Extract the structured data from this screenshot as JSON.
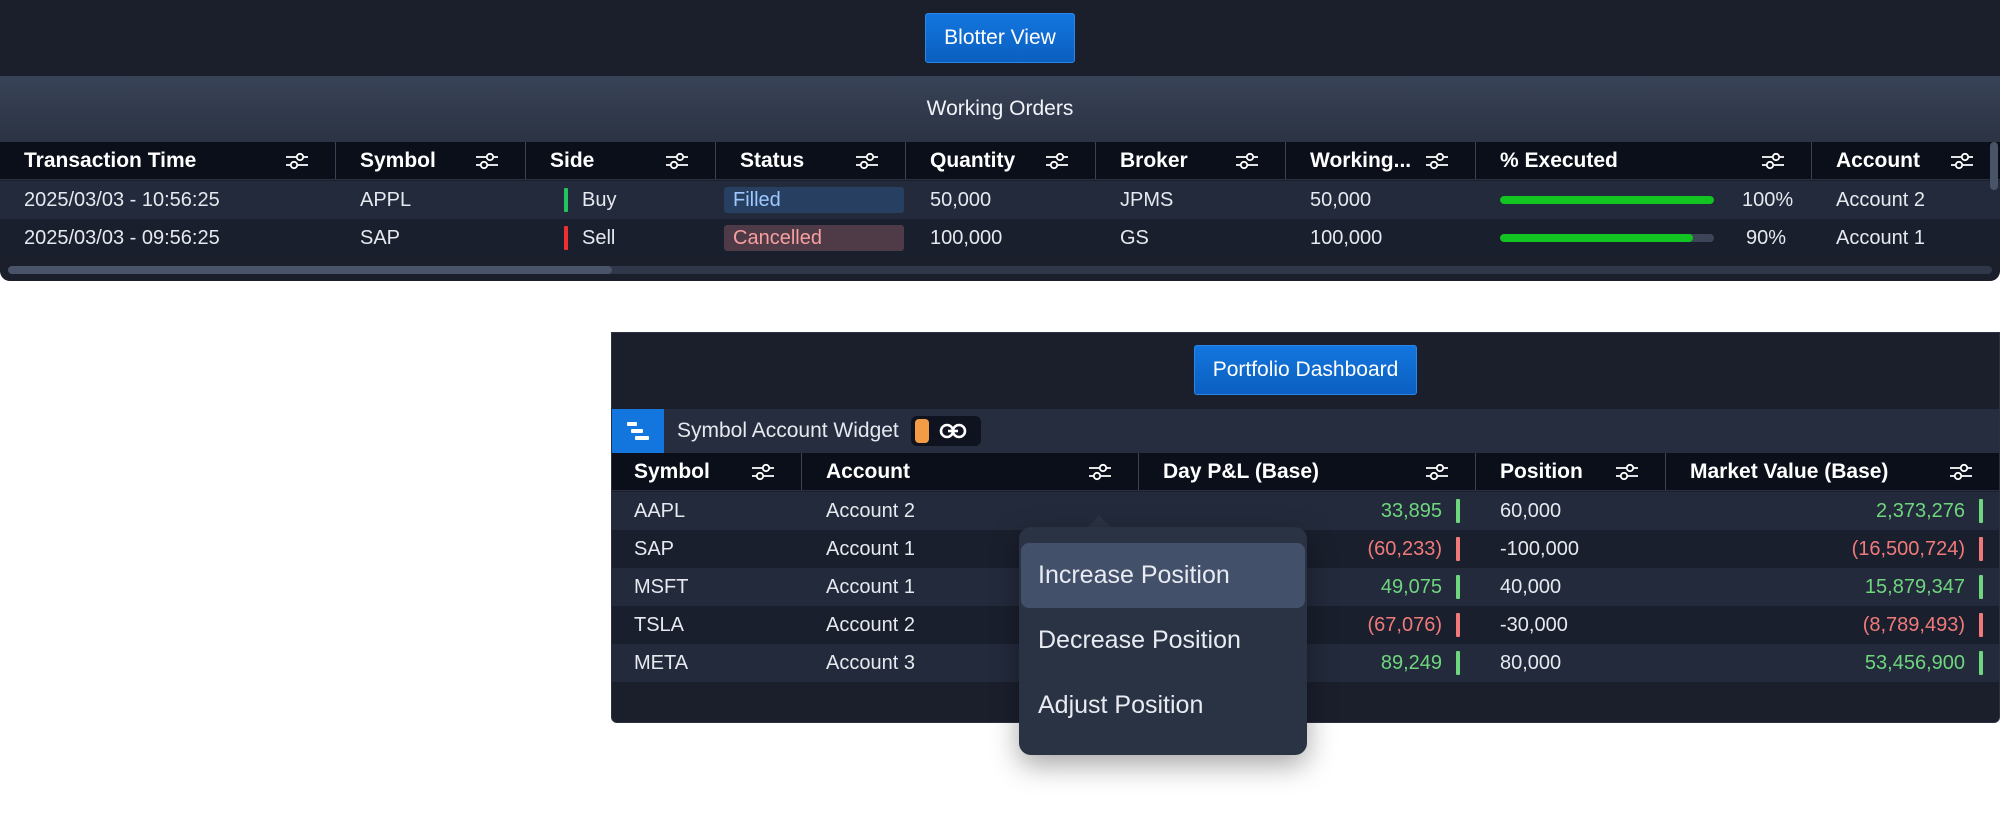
{
  "blotter": {
    "button_label": "Blotter View",
    "title": "Working Orders",
    "columns": [
      {
        "label": "Transaction Time",
        "filter": "filter-icon"
      },
      {
        "label": "Symbol",
        "filter": "filter-icon"
      },
      {
        "label": "Side",
        "filter": "filter-icon"
      },
      {
        "label": "Status",
        "filter": "filter-icon"
      },
      {
        "label": "Quantity",
        "filter": "filter-icon"
      },
      {
        "label": "Broker",
        "filter": "filter-icon"
      },
      {
        "label": "Working...",
        "filter": "filter-icon"
      },
      {
        "label": "% Executed",
        "filter": "filter-icon"
      },
      {
        "label": "Account",
        "filter": "filter-icon"
      }
    ],
    "rows": [
      {
        "time": "2025/03/03 - 10:56:25",
        "symbol": "APPL",
        "side": "Buy",
        "side_color": "#22c55e",
        "status": "Filled",
        "status_bg": "#274062",
        "status_color": "#9ec8ff",
        "quantity": "50,000",
        "broker": "JPMS",
        "working": "50,000",
        "executed_fraction": 1.0,
        "executed_label": "100%",
        "account": "Account 2"
      },
      {
        "time": "2025/03/03 - 09:56:25",
        "symbol": "SAP",
        "side": "Sell",
        "side_color": "#ef3030",
        "status": "Cancelled",
        "status_bg": "#4f3a47",
        "status_color": "#f6a0a0",
        "quantity": "100,000",
        "broker": "GS",
        "working": "100,000",
        "executed_fraction": 0.9,
        "executed_label": "90%",
        "account": "Account 1"
      }
    ]
  },
  "portfolio": {
    "button_label": "Portfolio Dashboard",
    "widget_icon": "stack-icon",
    "widget_title": "Symbol Account Widget",
    "link_icon": "link-icon",
    "columns": [
      {
        "label": "Symbol"
      },
      {
        "label": "Account"
      },
      {
        "label": "Day P&L (Base)"
      },
      {
        "label": "Position"
      },
      {
        "label": "Market Value (Base)"
      }
    ],
    "rows": [
      {
        "symbol": "AAPL",
        "account": "Account 2",
        "pnl": "33,895",
        "pnl_sign": "pos",
        "position": "60,000",
        "market_value": "2,373,276",
        "mv_sign": "pos"
      },
      {
        "symbol": "SAP",
        "account": "Account 1",
        "pnl": "(60,233)",
        "pnl_sign": "neg",
        "position": "-100,000",
        "market_value": "(16,500,724)",
        "mv_sign": "neg"
      },
      {
        "symbol": "MSFT",
        "account": "Account 1",
        "pnl": "49,075",
        "pnl_sign": "pos",
        "position": "40,000",
        "market_value": "15,879,347",
        "mv_sign": "pos"
      },
      {
        "symbol": "TSLA",
        "account": "Account 2",
        "pnl": "(67,076)",
        "pnl_sign": "neg",
        "position": "-30,000",
        "market_value": "(8,789,493)",
        "mv_sign": "neg"
      },
      {
        "symbol": "META",
        "account": "Account 3",
        "pnl": "89,249",
        "pnl_sign": "pos",
        "position": "80,000",
        "market_value": "53,456,900",
        "mv_sign": "pos"
      }
    ]
  },
  "context_menu": {
    "items": [
      {
        "label": "Increase Position",
        "active": true
      },
      {
        "label": "Decrease Position",
        "active": false
      },
      {
        "label": "Adjust Position",
        "active": false
      }
    ]
  },
  "colors": {
    "positive": "#6fd67e",
    "negative": "#f07a7a",
    "accent": "#1376de",
    "progress": "#11c421"
  }
}
